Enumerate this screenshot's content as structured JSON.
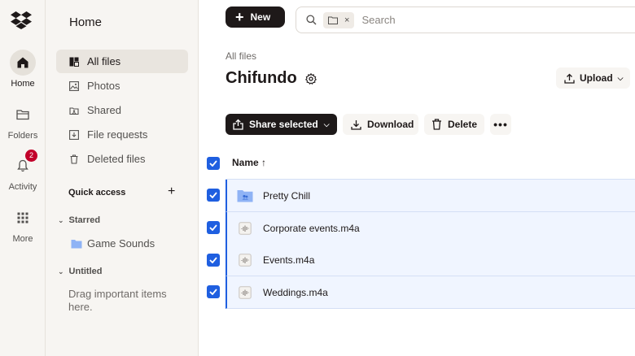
{
  "rail": {
    "items": [
      {
        "label": "Home",
        "icon": "home-icon"
      },
      {
        "label": "Folders",
        "icon": "folder-icon"
      },
      {
        "label": "Activity",
        "icon": "bell-icon",
        "badge": "2"
      },
      {
        "label": "More",
        "icon": "grid-icon"
      }
    ]
  },
  "sidebar": {
    "title": "Home",
    "nav": [
      {
        "label": "All files",
        "icon": "files-icon"
      },
      {
        "label": "Photos",
        "icon": "photo-icon"
      },
      {
        "label": "Shared",
        "icon": "shared-icon"
      },
      {
        "label": "File requests",
        "icon": "file-request-icon"
      },
      {
        "label": "Deleted files",
        "icon": "trash-icon"
      }
    ],
    "quick_access": "Quick access",
    "quick_access_add": "+",
    "starred": "Starred",
    "starred_items": [
      "Game Sounds"
    ],
    "untitled": "Untitled",
    "drag_hint": "Drag important items here."
  },
  "toolbar": {
    "new_label": "New",
    "search_placeholder": "Search",
    "search_chip_close": "×"
  },
  "header": {
    "breadcrumb": "All files",
    "title": "Chifundo",
    "upload_label": "Upload"
  },
  "actions": {
    "share_label": "Share selected",
    "download_label": "Download",
    "delete_label": "Delete",
    "more_label": "•••"
  },
  "table": {
    "name_header": "Name ↑",
    "rows": [
      {
        "name": "Pretty Chill",
        "type": "folder",
        "selected": true
      },
      {
        "name": "Corporate events.m4a",
        "type": "audio",
        "selected": true
      },
      {
        "name": "Events.m4a",
        "type": "audio",
        "selected": true
      },
      {
        "name": "Weddings.m4a",
        "type": "audio",
        "selected": true
      }
    ]
  },
  "colors": {
    "accent": "#1f5fe0",
    "selected_row": "#f0f5ff",
    "dark_button": "#1e1919",
    "badge": "#c2002a"
  }
}
